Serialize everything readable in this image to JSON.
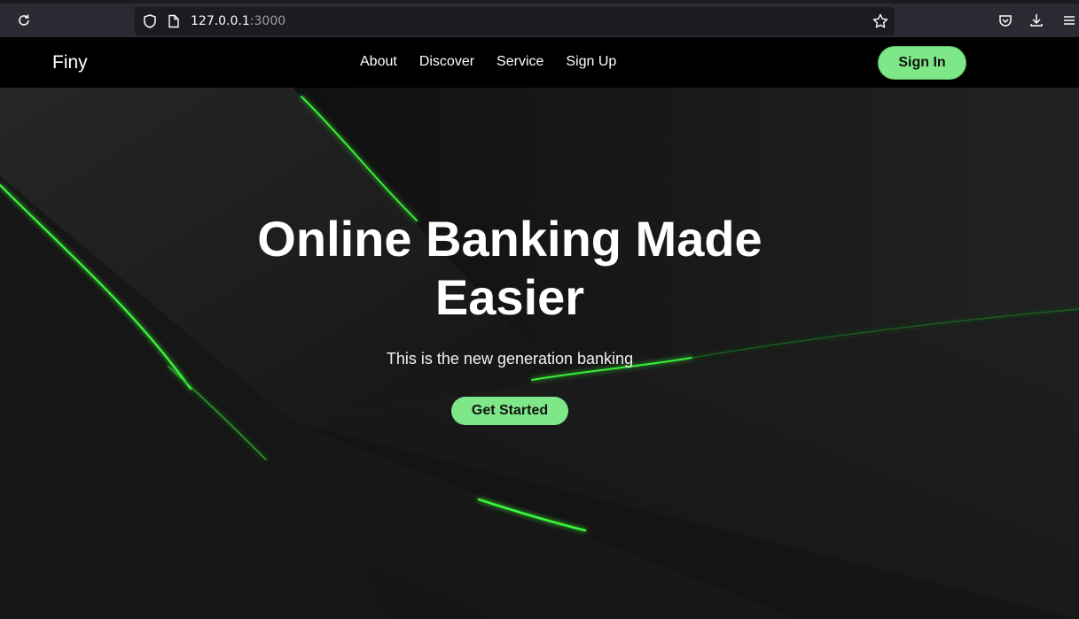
{
  "browser": {
    "url_host": "127.0.0.1",
    "url_port": ":3000"
  },
  "nav": {
    "logo": "Finy",
    "links": [
      "About",
      "Discover",
      "Service",
      "Sign Up"
    ],
    "signin_label": "Sign In"
  },
  "hero": {
    "title_line1": "Online Banking Made",
    "title_line2": "Easier",
    "subtitle": "This is the new generation banking",
    "cta_label": "Get Started"
  },
  "colors": {
    "accent": "#7ee787",
    "nav_bg": "#000000",
    "glow": "#39ff14"
  }
}
